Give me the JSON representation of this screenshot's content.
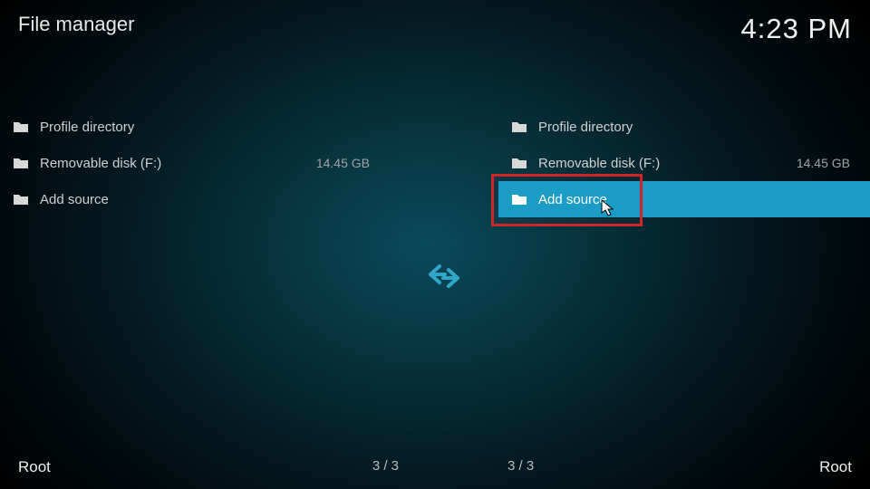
{
  "header": {
    "title": "File manager",
    "clock": "4:23 PM"
  },
  "left_pane": {
    "items": [
      {
        "label": "Profile directory",
        "meta": ""
      },
      {
        "label": "Removable disk (F:)",
        "meta": "14.45 GB"
      },
      {
        "label": "Add source",
        "meta": ""
      }
    ],
    "footer_label": "Root",
    "footer_count": "3 / 3"
  },
  "right_pane": {
    "items": [
      {
        "label": "Profile directory",
        "meta": ""
      },
      {
        "label": "Removable disk (F:)",
        "meta": "14.45 GB"
      },
      {
        "label": "Add source",
        "meta": ""
      }
    ],
    "selected_index": 2,
    "footer_label": "Root",
    "footer_count": "3 / 3"
  }
}
